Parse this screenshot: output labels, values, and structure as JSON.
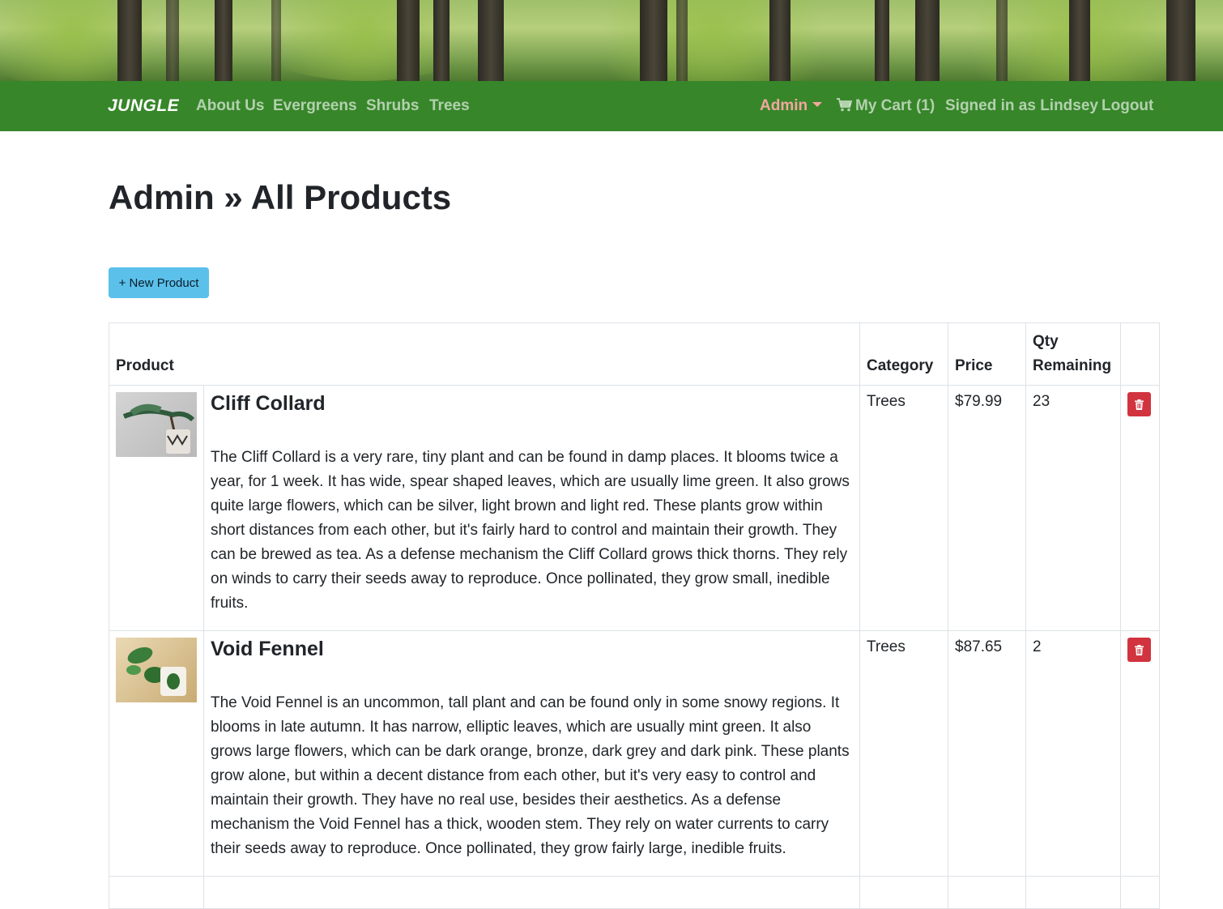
{
  "navbar": {
    "brand": "JUNGLE",
    "links": [
      "About Us",
      "Evergreens",
      "Shrubs",
      "Trees"
    ],
    "admin": "Admin",
    "cart": "My Cart (1)",
    "signed_in": "Signed in as Lindsey",
    "logout": "Logout"
  },
  "page": {
    "title": "Admin » All Products",
    "new_button": "+ New Product"
  },
  "table": {
    "headers": {
      "product": "Product",
      "category": "Category",
      "price": "Price",
      "qty": "Qty Remaining"
    },
    "rows": [
      {
        "name": "Cliff Collard",
        "description": "The Cliff Collard is a very rare, tiny plant and can be found in damp places. It blooms twice a year, for 1 week. It has wide, spear shaped leaves, which are usually lime green. It also grows quite large flowers, which can be silver, light brown and light red. These plants grow within short distances from each other, but it's fairly hard to control and maintain their growth. They can be brewed as tea. As a defense mechanism the Cliff Collard grows thick thorns. They rely on winds to carry their seeds away to reproduce. Once pollinated, they grow small, inedible fruits.",
        "category": "Trees",
        "price": "$79.99",
        "qty": "23"
      },
      {
        "name": "Void Fennel",
        "description": "The Void Fennel is an uncommon, tall plant and can be found only in some snowy regions. It blooms in late autumn. It has narrow, elliptic leaves, which are usually mint green. It also grows large flowers, which can be dark orange, bronze, dark grey and dark pink. These plants grow alone, but within a decent distance from each other, but it's very easy to control and maintain their growth. They have no real use, besides their aesthetics. As a defense mechanism the Void Fennel has a thick, wooden stem. They rely on water currents to carry their seeds away to reproduce. Once pollinated, they grow fairly large, inedible fruits.",
        "category": "Trees",
        "price": "$87.65",
        "qty": "2"
      }
    ]
  },
  "colors": {
    "navbar": "#37862a",
    "admin_link": "#f3a79f",
    "new_button": "#5bc0ea",
    "delete_button": "#d1343f"
  },
  "icons": [
    "cart-icon",
    "trash-icon",
    "caret-down-icon"
  ]
}
